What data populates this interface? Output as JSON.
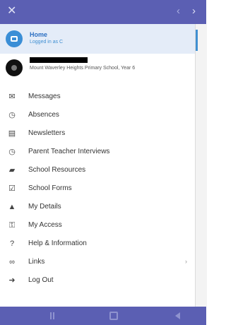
{
  "header": {
    "close_icon": "close-icon",
    "prev_icon": "chevron-left-icon",
    "next_icon": "chevron-right-icon"
  },
  "profile": {
    "home_title": "Home",
    "home_subtitle": "Logged in as C",
    "child_school": "Mount Waverley Heights Primary School, Year 6"
  },
  "menu": [
    {
      "label": "Messages",
      "icon": "envelope-icon"
    },
    {
      "label": "Absences",
      "icon": "clock-icon"
    },
    {
      "label": "Newsletters",
      "icon": "newspaper-icon"
    },
    {
      "label": "Parent Teacher Interviews",
      "icon": "clock-icon"
    },
    {
      "label": "School Resources",
      "icon": "folder-icon"
    },
    {
      "label": "School Forms",
      "icon": "form-icon"
    },
    {
      "label": "My Details",
      "icon": "person-icon"
    },
    {
      "label": "My Access",
      "icon": "key-icon"
    },
    {
      "label": "Help & Information",
      "icon": "help-icon"
    },
    {
      "label": "Links",
      "icon": "link-icon"
    },
    {
      "label": "Log Out",
      "icon": "logout-icon"
    }
  ],
  "colors": {
    "accent": "#5b5fb3",
    "highlight": "#e4ecf8",
    "link": "#2c6fc2"
  }
}
